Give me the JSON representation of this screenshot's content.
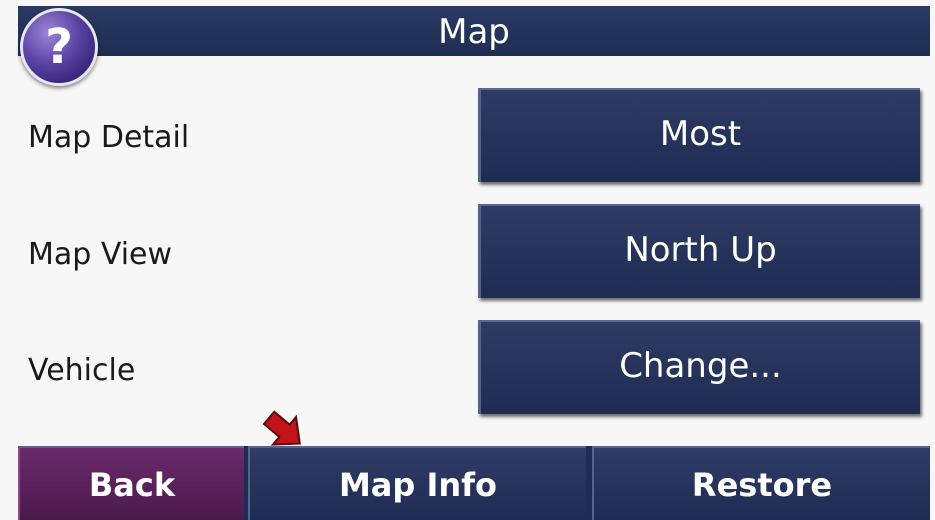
{
  "header": {
    "title": "Map",
    "help_icon": "question-mark-icon",
    "help_glyph": "?"
  },
  "settings": [
    {
      "label": "Map Detail",
      "value": "Most"
    },
    {
      "label": "Map View",
      "value": "North Up"
    },
    {
      "label": "Vehicle",
      "value": "Change..."
    }
  ],
  "bottom_bar": {
    "back_label": "Back",
    "map_info_label": "Map Info",
    "restore_label": "Restore"
  },
  "annotation": {
    "icon": "red-pointer-arrow-icon",
    "color": "#c0141a"
  },
  "colors": {
    "button_blue": "#1e2b52",
    "back_purple": "#5a2259",
    "help_purple": "#4b3494",
    "background": "#f7f7f7"
  }
}
